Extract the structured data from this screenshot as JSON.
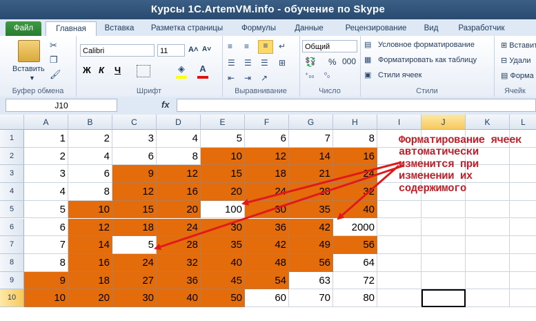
{
  "window_title": "Курсы 1С.ArtemVM.info - обучение по Skype",
  "ribbon_tabs": [
    "Файл",
    "Главная",
    "Вставка",
    "Разметка страницы",
    "Формулы",
    "Данные",
    "Рецензирование",
    "Вид",
    "Разработчик"
  ],
  "groups": {
    "clipboard": {
      "label": "Буфер обмена",
      "paste": "Вставить"
    },
    "font": {
      "label": "Шрифт",
      "font_name": "Calibri",
      "font_size": "11",
      "bold": "Ж",
      "italic": "К",
      "underline": "Ч",
      "grow": "A˄",
      "shrink": "A˅"
    },
    "alignment": {
      "label": "Выравнивание"
    },
    "number": {
      "label": "Число",
      "format": "Общий",
      "percent": "%",
      "thousands": "000"
    },
    "styles": {
      "label": "Стили",
      "conditional": "Условное форматирование",
      "as_table": "Форматировать как таблицу",
      "cell_styles": "Стили ячеек"
    },
    "cells": {
      "label": "Ячейк",
      "insert": "Вставить",
      "delete": "Удали",
      "format": "Форма"
    }
  },
  "name_box": "J10",
  "fx_label": "fx",
  "columns": [
    "A",
    "B",
    "C",
    "D",
    "E",
    "F",
    "G",
    "H",
    "I",
    "J",
    "K",
    "L"
  ],
  "rows": [
    "1",
    "2",
    "3",
    "4",
    "5",
    "6",
    "7",
    "8",
    "9",
    "10"
  ],
  "cells": [
    [
      "1",
      "2",
      "3",
      "4",
      "5",
      "6",
      "7",
      "8"
    ],
    [
      "2",
      "4",
      "6",
      "8",
      "10",
      "12",
      "14",
      "16"
    ],
    [
      "3",
      "6",
      "9",
      "12",
      "15",
      "18",
      "21",
      "24"
    ],
    [
      "4",
      "8",
      "12",
      "16",
      "20",
      "24",
      "28",
      "32"
    ],
    [
      "5",
      "10",
      "15",
      "20",
      "100",
      "30",
      "35",
      "40"
    ],
    [
      "6",
      "12",
      "18",
      "24",
      "30",
      "36",
      "42",
      "2000"
    ],
    [
      "7",
      "14",
      "5",
      "28",
      "35",
      "42",
      "49",
      "56"
    ],
    [
      "8",
      "16",
      "24",
      "32",
      "40",
      "48",
      "56",
      "64"
    ],
    [
      "9",
      "18",
      "27",
      "36",
      "45",
      "54",
      "63",
      "72"
    ],
    [
      "10",
      "20",
      "30",
      "40",
      "50",
      "60",
      "70",
      "80"
    ]
  ],
  "highlighted": [
    [
      0,
      0,
      0,
      0,
      0,
      0,
      0,
      0
    ],
    [
      0,
      0,
      0,
      0,
      1,
      1,
      1,
      1
    ],
    [
      0,
      0,
      1,
      1,
      1,
      1,
      1,
      1
    ],
    [
      0,
      0,
      1,
      1,
      1,
      1,
      1,
      1
    ],
    [
      0,
      1,
      1,
      1,
      0,
      1,
      1,
      1
    ],
    [
      0,
      1,
      1,
      1,
      1,
      1,
      1,
      0
    ],
    [
      0,
      1,
      0,
      1,
      1,
      1,
      1,
      1
    ],
    [
      0,
      1,
      1,
      1,
      1,
      1,
      1,
      0
    ],
    [
      1,
      1,
      1,
      1,
      1,
      1,
      0,
      0
    ],
    [
      1,
      1,
      1,
      1,
      1,
      0,
      0,
      0
    ]
  ],
  "annotation": "Форматирование ячеек автоматически изменится при изменении их содержимого",
  "colors": {
    "highlight": "#e46c0a",
    "annotation": "#c0202a",
    "file_tab": "#2a7c2f"
  }
}
